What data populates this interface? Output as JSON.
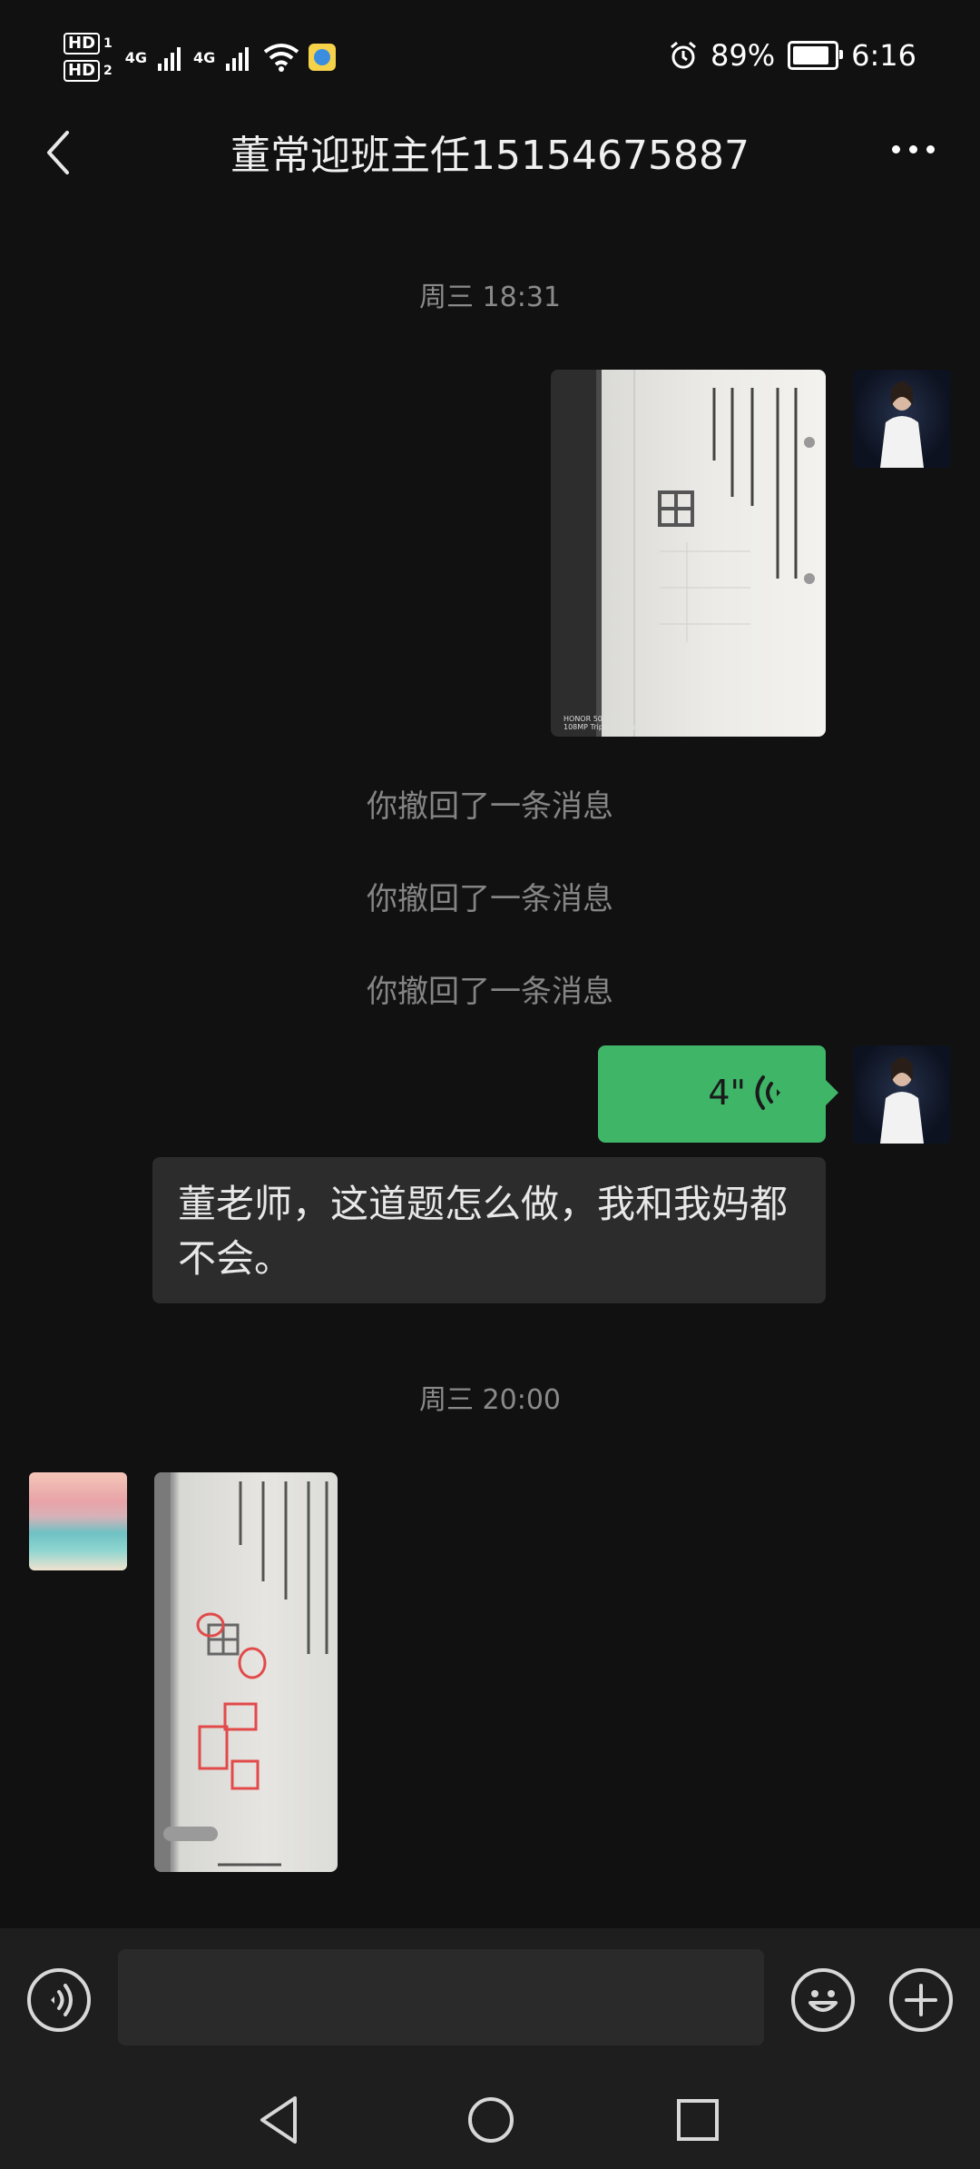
{
  "status_bar": {
    "hd1": "HD",
    "hd1_num": "1",
    "hd2": "HD",
    "hd2_num": "2",
    "net1": "4G",
    "net2": "4G",
    "battery_percent": "89%",
    "battery_level": 0.89,
    "time": "6:16"
  },
  "header": {
    "title": "董常迎班主任15154675887"
  },
  "messages": {
    "time1": "周三 18:31",
    "recalled_1": "你撤回了一条消息",
    "recalled_2": "你撤回了一条消息",
    "recalled_3": "你撤回了一条消息",
    "voice_duration": "4\"",
    "text_message": "董老师，这道题怎么做，我和我妈都不会。",
    "time2": "周三 20:00",
    "photo1_watermark_1": "HONOR 50 SE",
    "photo1_watermark_2": "108MP Triple Camera"
  },
  "icons": {
    "back": "back-arrow-icon",
    "more": "more-icon",
    "voice_input": "voice-input-icon",
    "emoji": "emoji-icon",
    "plus": "plus-icon",
    "nav_back": "nav-back-icon",
    "nav_home": "nav-home-icon",
    "nav_recent": "nav-recent-icon"
  },
  "colors": {
    "background": "#111111",
    "voice_bubble": "#3fb568",
    "text_bubble": "#2c2c2c"
  }
}
